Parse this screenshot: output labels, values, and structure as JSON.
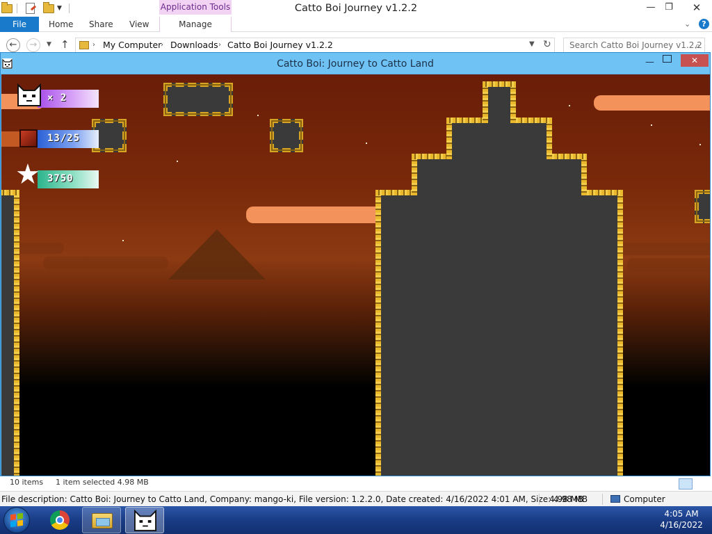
{
  "explorer": {
    "title": "Catto Boi Journey v1.2.2",
    "context_tab_group": "Application Tools",
    "tabs": {
      "file": "File",
      "home": "Home",
      "share": "Share",
      "view": "View",
      "manage": "Manage"
    },
    "breadcrumbs": [
      "My Computer",
      "Downloads",
      "Catto Boi Journey v1.2.2"
    ],
    "search_placeholder": "Search Catto Boi Journey v1.2.2",
    "status": {
      "items": "10 items",
      "selected": "1 item selected  4.98 MB"
    },
    "details": {
      "description": "File description: Catto Boi: Journey to Catto Land, Company: mango-ki, File version: 1.2.2.0, Date created: 4/16/2022 4:01 AM, Size: 4.98 MB",
      "size": "4.98 MB",
      "location": "Computer"
    }
  },
  "game": {
    "window_title": "Catto Boi: Journey to Catto Land",
    "hud": {
      "lives": "× 2",
      "boxes": "13/25",
      "score": "3750"
    }
  },
  "taskbar": {
    "time": "4:05 AM",
    "date": "4/16/2022"
  },
  "colors": {
    "file_tab": "#1979ca",
    "context_tab": "#f3d3f3",
    "game_frame": "#5cb6ef",
    "sky_top": "#6a1d08",
    "cloud": "#f3925a",
    "block_gold": "#e9b82c",
    "block_fill": "#3a3a3a",
    "taskbar": "#1a3c86"
  },
  "icons": [
    "folder-icon",
    "properties-icon",
    "back-icon",
    "forward-icon",
    "up-icon",
    "refresh-icon",
    "search-icon",
    "help-icon",
    "cat-icon",
    "box-icon",
    "star-icon",
    "windows-logo-icon",
    "chrome-icon",
    "computer-icon"
  ]
}
